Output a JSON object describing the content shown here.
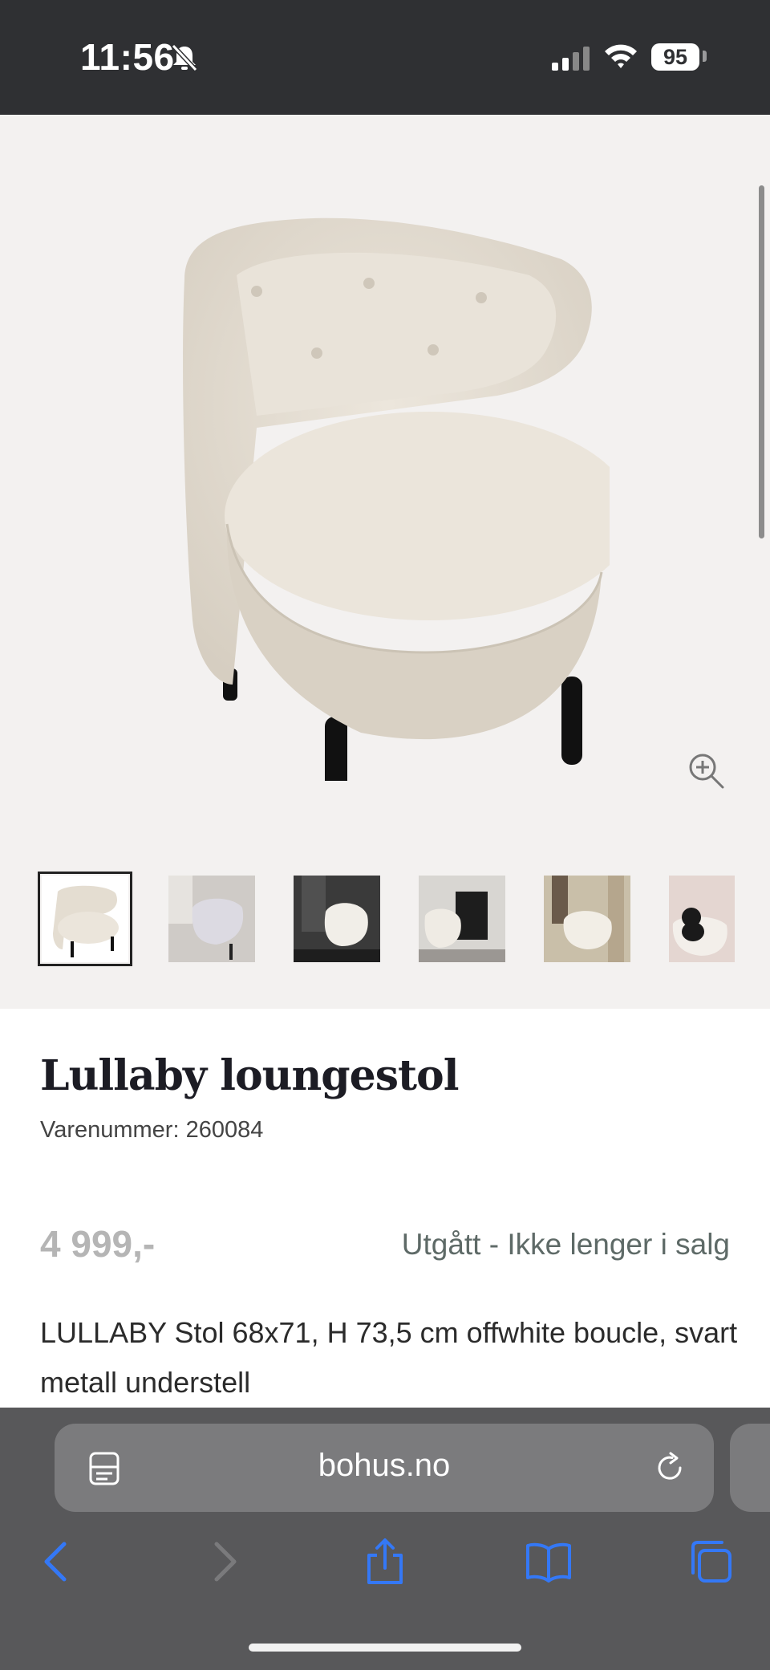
{
  "status": {
    "time": "11:56",
    "battery": "95"
  },
  "product": {
    "title": "Lullaby loungestol",
    "sku": "Varenummer: 260084",
    "price": "4 999,-",
    "availability": "Utgått - Ikke lenger i salg",
    "description": "LULLABY Stol 68x71, H 73,5 cm offwhite boucle, svart metall understell"
  },
  "gallery": {
    "thumbnail_count": 6,
    "selected_index": 0
  },
  "browser": {
    "url": "bohus.no"
  },
  "colors": {
    "accent": "#3478f6",
    "status_bar": "#2f3033",
    "browser_chrome": "#58585a",
    "price_grey": "#b5b5b5"
  },
  "icons": [
    "bell-slash-icon",
    "signal-icon",
    "wifi-icon",
    "zoom-in-icon",
    "reader-icon",
    "reload-icon",
    "back-icon",
    "forward-icon",
    "share-icon",
    "bookmarks-icon",
    "tabs-icon"
  ]
}
